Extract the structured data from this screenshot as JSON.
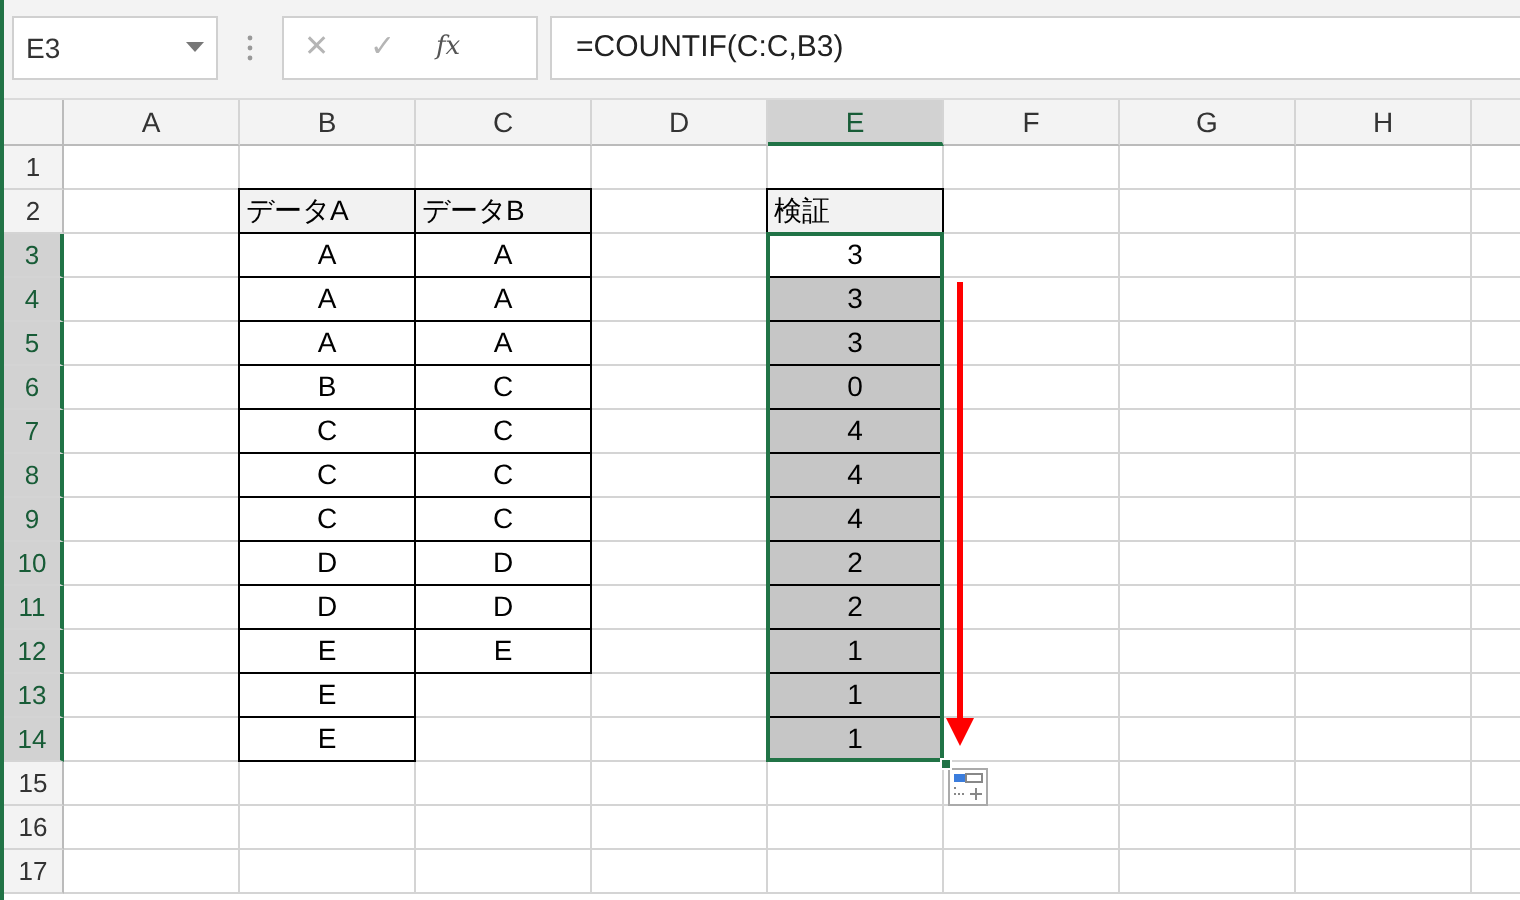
{
  "name_box": {
    "value": "E3"
  },
  "formula_bar": {
    "cancel": "✕",
    "enter": "✓",
    "function": "fx",
    "formula": "=COUNTIF(C:C,B3)"
  },
  "columns": [
    {
      "label": "A",
      "selected": false
    },
    {
      "label": "B",
      "selected": false
    },
    {
      "label": "C",
      "selected": false
    },
    {
      "label": "D",
      "selected": false
    },
    {
      "label": "E",
      "selected": true
    },
    {
      "label": "F",
      "selected": false
    },
    {
      "label": "G",
      "selected": false
    },
    {
      "label": "H",
      "selected": false
    }
  ],
  "rows": [
    {
      "label": "1",
      "selected": false,
      "cells": [
        {},
        {},
        {},
        {},
        {},
        {},
        {},
        {}
      ]
    },
    {
      "label": "2",
      "selected": false,
      "cells": [
        {},
        {
          "kind": "header",
          "text": "データA"
        },
        {
          "kind": "header",
          "text": "データB"
        },
        {},
        {
          "kind": "header",
          "text": "検証"
        },
        {},
        {},
        {}
      ]
    },
    {
      "label": "3",
      "selected": true,
      "cells": [
        {},
        {
          "kind": "data",
          "text": "A"
        },
        {
          "kind": "data",
          "text": "A"
        },
        {},
        {
          "kind": "data",
          "text": "3",
          "selected": true,
          "active": true
        },
        {},
        {},
        {}
      ]
    },
    {
      "label": "4",
      "selected": true,
      "cells": [
        {},
        {
          "kind": "data",
          "text": "A"
        },
        {
          "kind": "data",
          "text": "A"
        },
        {},
        {
          "kind": "data",
          "text": "3",
          "selected": true,
          "active": false
        },
        {},
        {},
        {}
      ]
    },
    {
      "label": "5",
      "selected": true,
      "cells": [
        {},
        {
          "kind": "data",
          "text": "A"
        },
        {
          "kind": "data",
          "text": "A"
        },
        {},
        {
          "kind": "data",
          "text": "3",
          "selected": true,
          "active": false
        },
        {},
        {},
        {}
      ]
    },
    {
      "label": "6",
      "selected": true,
      "cells": [
        {},
        {
          "kind": "data",
          "text": "B"
        },
        {
          "kind": "data",
          "text": "C"
        },
        {},
        {
          "kind": "data",
          "text": "0",
          "selected": true,
          "active": false
        },
        {},
        {},
        {}
      ]
    },
    {
      "label": "7",
      "selected": true,
      "cells": [
        {},
        {
          "kind": "data",
          "text": "C"
        },
        {
          "kind": "data",
          "text": "C"
        },
        {},
        {
          "kind": "data",
          "text": "4",
          "selected": true,
          "active": false
        },
        {},
        {},
        {}
      ]
    },
    {
      "label": "8",
      "selected": true,
      "cells": [
        {},
        {
          "kind": "data",
          "text": "C"
        },
        {
          "kind": "data",
          "text": "C"
        },
        {},
        {
          "kind": "data",
          "text": "4",
          "selected": true,
          "active": false
        },
        {},
        {},
        {}
      ]
    },
    {
      "label": "9",
      "selected": true,
      "cells": [
        {},
        {
          "kind": "data",
          "text": "C"
        },
        {
          "kind": "data",
          "text": "C"
        },
        {},
        {
          "kind": "data",
          "text": "4",
          "selected": true,
          "active": false
        },
        {},
        {},
        {}
      ]
    },
    {
      "label": "10",
      "selected": true,
      "cells": [
        {},
        {
          "kind": "data",
          "text": "D"
        },
        {
          "kind": "data",
          "text": "D"
        },
        {},
        {
          "kind": "data",
          "text": "2",
          "selected": true,
          "active": false
        },
        {},
        {},
        {}
      ]
    },
    {
      "label": "11",
      "selected": true,
      "cells": [
        {},
        {
          "kind": "data",
          "text": "D"
        },
        {
          "kind": "data",
          "text": "D"
        },
        {},
        {
          "kind": "data",
          "text": "2",
          "selected": true,
          "active": false
        },
        {},
        {},
        {}
      ]
    },
    {
      "label": "12",
      "selected": true,
      "cells": [
        {},
        {
          "kind": "data",
          "text": "E"
        },
        {
          "kind": "data",
          "text": "E"
        },
        {},
        {
          "kind": "data",
          "text": "1",
          "selected": true,
          "active": false
        },
        {},
        {},
        {}
      ]
    },
    {
      "label": "13",
      "selected": true,
      "cells": [
        {},
        {
          "kind": "data",
          "text": "E"
        },
        {},
        {},
        {
          "kind": "data",
          "text": "1",
          "selected": true,
          "active": false
        },
        {},
        {},
        {}
      ]
    },
    {
      "label": "14",
      "selected": true,
      "cells": [
        {},
        {
          "kind": "data",
          "text": "E"
        },
        {},
        {},
        {
          "kind": "data",
          "text": "1",
          "selected": true,
          "active": false
        },
        {},
        {},
        {}
      ]
    },
    {
      "label": "15",
      "selected": false,
      "cells": [
        {},
        {},
        {},
        {},
        {},
        {},
        {},
        {}
      ]
    },
    {
      "label": "16",
      "selected": false,
      "cells": [
        {},
        {},
        {},
        {},
        {},
        {},
        {},
        {}
      ]
    },
    {
      "label": "17",
      "selected": false,
      "cells": [
        {},
        {},
        {},
        {},
        {},
        {},
        {},
        {}
      ]
    }
  ]
}
